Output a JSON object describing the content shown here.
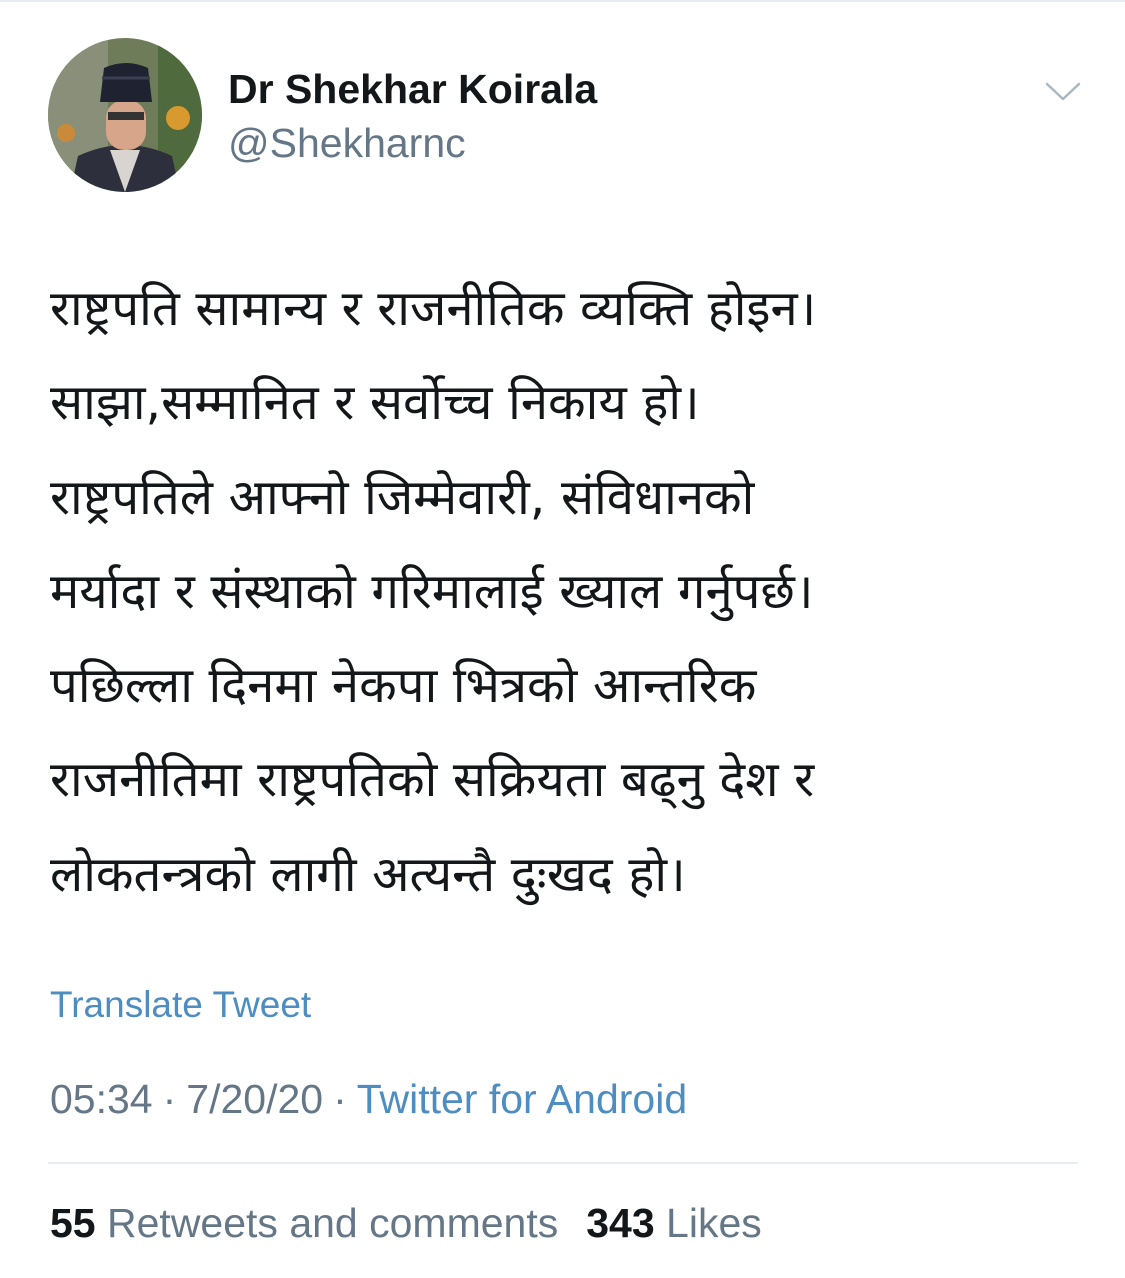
{
  "user": {
    "display_name": "Dr Shekhar Koirala",
    "handle": "@Shekharnc",
    "avatar_icon": "profile-photo"
  },
  "menu_icon": "chevron-down-icon",
  "tweet": {
    "lines": [
      "राष्ट्रपति सामान्य र राजनीतिक व्यक्ति होइन।",
      "साझा,सम्मानित र सर्वोच्च निकाय हो।",
      "राष्ट्रपतिले आफ्नो जिम्मेवारी, संविधानको",
      "मर्यादा र संस्थाको गरिमालाई ख्याल गर्नुपर्छ।",
      "पछिल्ला दिनमा नेकपा भित्रको आन्तरिक",
      "राजनीतिमा राष्ट्रपतिको सक्रियता बढ्नु देश र",
      "लोकतन्त्रको लागी अत्यन्तै दुःखद हो।"
    ],
    "translate_label": "Translate Tweet"
  },
  "meta": {
    "time": "05:34",
    "separator": "·",
    "date": "7/20/20",
    "source": "Twitter for Android"
  },
  "stats": {
    "retweets_count": "55",
    "retweets_label": "Retweets and comments",
    "likes_count": "343",
    "likes_label": "Likes"
  },
  "colors": {
    "text_primary": "#14171a",
    "text_secondary": "#657786",
    "link": "#4d8dc1",
    "divider": "#e6ecf0"
  }
}
